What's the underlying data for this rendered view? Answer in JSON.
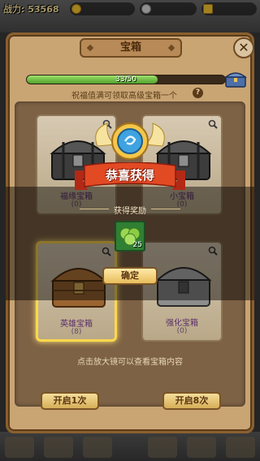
{
  "topbar": {
    "power_label": "战力: 53568",
    "currencies": [
      "",
      "",
      ""
    ]
  },
  "panel": {
    "title": "宝箱",
    "close_symbol": "✕",
    "progress": {
      "text": "33/50",
      "value": 33,
      "max": 50
    },
    "hint_top": "祝福值满可领取高级宝箱一个",
    "help_symbol": "?",
    "hint_bottom": "点击放大镜可以查看宝箱内容",
    "chests": [
      {
        "name": "福缘宝箱",
        "count": "(0)",
        "icon": "black-chest-icon"
      },
      {
        "name": "小宝箱",
        "count": "(0)",
        "icon": "black-chest-icon"
      },
      {
        "name": "英雄宝箱",
        "count": "(8)",
        "icon": "wooden-chest-icon"
      },
      {
        "name": "强化宝箱",
        "count": "(0)",
        "icon": "steel-chest-icon"
      }
    ],
    "open_one_label": "开启1次",
    "open_eight_label": "开启8次"
  },
  "reward": {
    "title": "恭喜获得",
    "label": "获得奖励",
    "item_icon": "green-clover-icon",
    "item_qty": "25",
    "confirm_label": "确定"
  }
}
